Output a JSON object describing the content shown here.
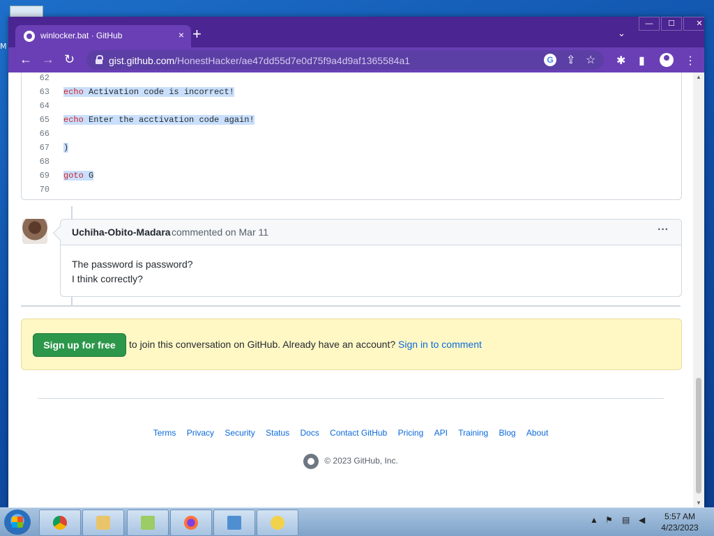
{
  "browser": {
    "tab": {
      "title": "winlocker.bat · GitHub",
      "close": "×"
    },
    "new_tab": "+",
    "tab_menu": "⌄",
    "window_buttons": {
      "minimize": "—",
      "maximize": "☐",
      "close": "✕"
    },
    "nav": {
      "back": "←",
      "forward": "→",
      "reload": "↻"
    },
    "url": {
      "host": "gist.github.com",
      "path": "/HonestHacker/ae47dd55d7e0d75f9a4d9af1365584a1"
    },
    "icons": {
      "share": "⇪",
      "star": "☆",
      "extensions": "✱",
      "sidepanel": "▮",
      "menu": "⋮"
    }
  },
  "code": {
    "lines": [
      {
        "num": "62",
        "keyword": "",
        "text": ""
      },
      {
        "num": "63",
        "keyword": "echo",
        "text": " Activation code is incorrect!"
      },
      {
        "num": "64",
        "keyword": "",
        "text": ""
      },
      {
        "num": "65",
        "keyword": "echo",
        "text": " Enter the acctivation code again!"
      },
      {
        "num": "66",
        "keyword": "",
        "text": ""
      },
      {
        "num": "67",
        "keyword": "",
        "text": ")"
      },
      {
        "num": "68",
        "keyword": "",
        "text": ""
      },
      {
        "num": "69",
        "keyword": "goto",
        "text": " G"
      },
      {
        "num": "70",
        "keyword": "",
        "text": ""
      }
    ]
  },
  "comment": {
    "author": "Uchiha-Obito-Madara",
    "meta": "commented on Mar 11",
    "more": "···",
    "body_lines": [
      "The password is password?",
      "I think correctly?"
    ]
  },
  "signup": {
    "button": "Sign up for free",
    "text": " to join this conversation on GitHub.",
    "text2": " Already have an account? ",
    "link": "Sign in to comment"
  },
  "footer": {
    "links": [
      "Terms",
      "Privacy",
      "Security",
      "Status",
      "Docs",
      "Contact GitHub",
      "Pricing",
      "API",
      "Training",
      "Blog",
      "About"
    ],
    "copyright": "© 2023 GitHub, Inc."
  },
  "taskbar": {
    "time": "5:57 AM",
    "date": "4/23/2023",
    "tray_chevron": "▲"
  }
}
